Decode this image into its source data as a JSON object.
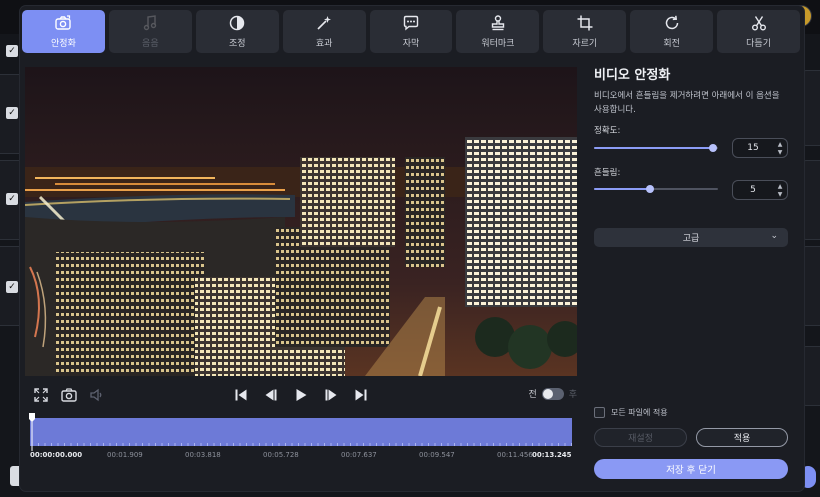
{
  "tabs": [
    {
      "label": "안정화",
      "icon": "stabilize-camera-icon",
      "state": "active"
    },
    {
      "label": "음음",
      "icon": "music-note-icon",
      "state": "disabled"
    },
    {
      "label": "조정",
      "icon": "contrast-icon",
      "state": "normal"
    },
    {
      "label": "효과",
      "icon": "magic-wand-icon",
      "state": "normal"
    },
    {
      "label": "자막",
      "icon": "subtitle-bubble-icon",
      "state": "normal"
    },
    {
      "label": "워터마크",
      "icon": "stamp-icon",
      "state": "normal"
    },
    {
      "label": "자르기",
      "icon": "crop-icon",
      "state": "normal"
    },
    {
      "label": "회전",
      "icon": "rotate-icon",
      "state": "normal"
    },
    {
      "label": "다듬기",
      "icon": "scissors-icon",
      "state": "normal"
    }
  ],
  "panel": {
    "title": "비디오 안정화",
    "description": "비디오에서 흔들림을 제거하려면 아래에서 이 옵션을 사용합니다.",
    "accuracy": {
      "label": "정확도:",
      "value": "15",
      "fraction": 0.96
    },
    "shakiness": {
      "label": "흔들림:",
      "value": "5",
      "fraction": 0.45
    },
    "advanced_label": "고급",
    "apply_all_label": "모든 파일에 적용",
    "reset_label": "재설정",
    "apply_label": "적용",
    "save_close_label": "저장 후 닫기"
  },
  "player": {
    "before_label": "전",
    "after_label": "후",
    "toggle_on": false
  },
  "timeline": {
    "current": "00:00:00.000",
    "end": "00:13.245",
    "marks": [
      "00:01.909",
      "00:03.818",
      "00:05.728",
      "00:07.637",
      "00:09.547",
      "00:11.456"
    ]
  },
  "colors": {
    "accent": "#7d8ff3",
    "track": "#6d7ad7",
    "panel_bg": "#1b1d23"
  }
}
